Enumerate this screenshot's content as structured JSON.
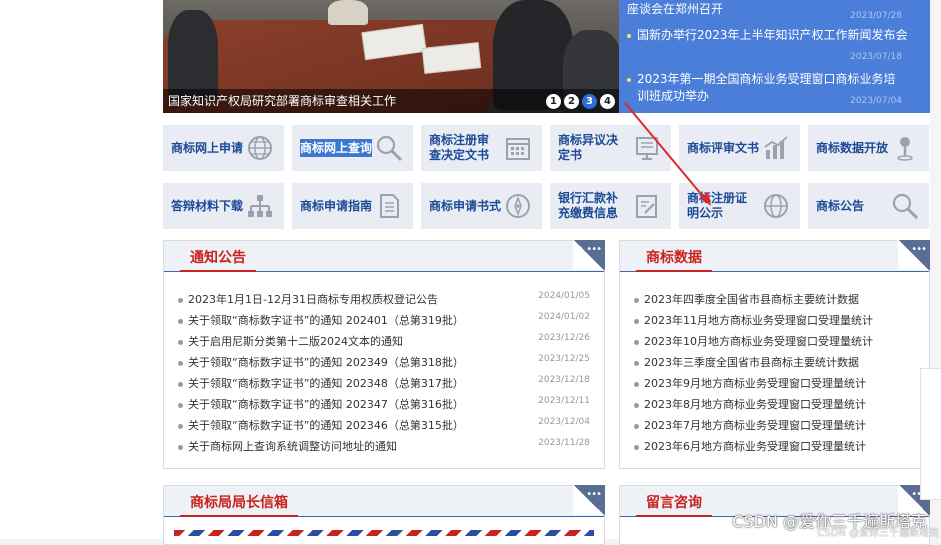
{
  "banner": {
    "caption": "国家知识产权局研究部署商标审查相关工作",
    "dots": [
      "1",
      "2",
      "3",
      "4"
    ],
    "active_dot": 3
  },
  "news": [
    {
      "title": "座谈会在郑州召开",
      "date": "2023/07/28"
    },
    {
      "title": "国新办举行2023年上半年知识产权工作新闻发布会",
      "date": "2023/07/18"
    },
    {
      "title": "2023年第一期全国商标业务受理窗口商标业务培训班成功举办",
      "date": "2023/07/04"
    }
  ],
  "tiles_row1": [
    {
      "label": "商标网上申请",
      "icon": "globe-icon"
    },
    {
      "label": "商标网上查询",
      "icon": "search-icon",
      "selected": true
    },
    {
      "label": "商标注册审查决定文书",
      "icon": "calendar-icon"
    },
    {
      "label": "商标异议决定书",
      "icon": "document-board-icon"
    },
    {
      "label": "商标评审文书",
      "icon": "bar-chart-icon"
    },
    {
      "label": "商标数据开放",
      "icon": "pin-icon"
    }
  ],
  "tiles_row2": [
    {
      "label": "答辩材料下载",
      "icon": "sitemap-icon"
    },
    {
      "label": "商标申请指南",
      "icon": "document-icon"
    },
    {
      "label": "商标申请书式",
      "icon": "compass-icon"
    },
    {
      "label": "银行汇款补充缴费信息",
      "icon": "edit-document-icon"
    },
    {
      "label": "商标注册证明公示",
      "icon": "globe-icon"
    },
    {
      "label": "商标公告",
      "icon": "search-icon"
    }
  ],
  "notices": {
    "title": "通知公告",
    "items": [
      {
        "text": "2023年1月1日-12月31日商标专用权质权登记公告",
        "date": "2024/01/05"
      },
      {
        "text": "关于领取“商标数字证书”的通知 202401（总第319批）",
        "date": "2024/01/02"
      },
      {
        "text": "关于启用尼斯分类第十二版2024文本的通知",
        "date": "2023/12/26"
      },
      {
        "text": "关于领取“商标数字证书”的通知 202349（总第318批）",
        "date": "2023/12/25"
      },
      {
        "text": "关于领取“商标数字证书”的通知 202348（总第317批）",
        "date": "2023/12/18"
      },
      {
        "text": "关于领取“商标数字证书”的通知 202347（总第316批）",
        "date": "2023/12/11"
      },
      {
        "text": "关于领取“商标数字证书”的通知 202346（总第315批）",
        "date": "2023/12/04"
      },
      {
        "text": "关于商标网上查询系统调整访问地址的通知",
        "date": "2023/11/28"
      }
    ]
  },
  "stats": {
    "title": "商标数据",
    "items": [
      {
        "text": "2023年四季度全国省市县商标主要统计数据"
      },
      {
        "text": "2023年11月地方商标业务受理窗口受理量统计"
      },
      {
        "text": "2023年10月地方商标业务受理窗口受理量统计"
      },
      {
        "text": "2023年三季度全国省市县商标主要统计数据"
      },
      {
        "text": "2023年9月地方商标业务受理窗口受理量统计"
      },
      {
        "text": "2023年8月地方商标业务受理窗口受理量统计"
      },
      {
        "text": "2023年7月地方商标业务受理窗口受理量统计"
      },
      {
        "text": "2023年6月地方商标业务受理窗口受理量统计"
      }
    ]
  },
  "director_mailbox": {
    "title": "商标局局长信箱"
  },
  "consult": {
    "title": "留言咨询"
  },
  "watermark": {
    "main": "CSDN @爱你三千遍斯塔克",
    "small": "CSDN @爱你三千遍斯塔克"
  },
  "colors": {
    "accent_blue": "#4a7ed8",
    "tile_text": "#1d4a96",
    "heading_red": "#c8231e",
    "arrow_red": "#e0282a"
  }
}
